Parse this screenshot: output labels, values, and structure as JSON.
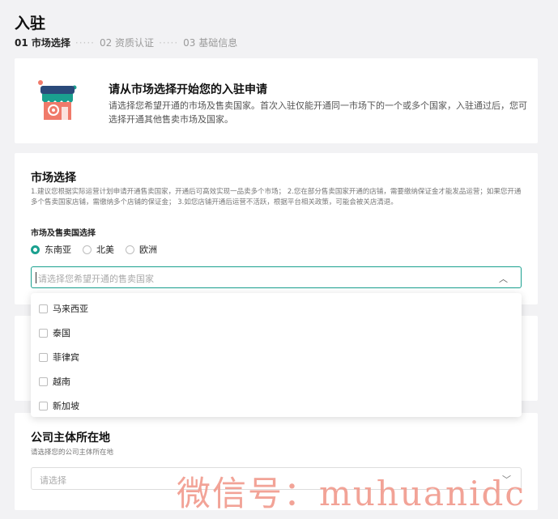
{
  "page": {
    "title": "入驻"
  },
  "steps": [
    {
      "label": "01 市场选择",
      "active": true
    },
    {
      "label": "02 资质认证",
      "active": false
    },
    {
      "label": "03 基础信息",
      "active": false
    }
  ],
  "steps_separator": "·····",
  "intro": {
    "icon": "shop-icon",
    "title": "请从市场选择开始您的入驻申请",
    "description": "请选择您希望开通的市场及售卖国家。首次入驻仅能开通同一市场下的一个或多个国家，入驻通过后，您可选择开通其他售卖市场及国家。"
  },
  "market": {
    "title": "市场选择",
    "description": "1.建议您根据实际运营计划申请开通售卖国家，开通后可高效实现一品卖多个市场； 2.您在部分售卖国家开通的店铺，需要缴纳保证金才能发品运营；如果您开通多个售卖国家店铺，需缴纳多个店铺的保证金； 3.如您店铺开通后运营不活跃，根据平台相关政策，可能会被关店清退。",
    "sub_label": "市场及售卖国选择",
    "regions": [
      {
        "label": "东南亚",
        "checked": true
      },
      {
        "label": "北美",
        "checked": false
      },
      {
        "label": "欧洲",
        "checked": false
      }
    ],
    "country_select": {
      "placeholder": "请选择您希望开通的售卖国家",
      "chevron": "chevron-up-icon"
    }
  },
  "country_options": [
    "马来西亚",
    "泰国",
    "菲律宾",
    "越南",
    "新加坡"
  ],
  "company": {
    "title": "公司主体所在地",
    "subtitle": "请选择您的公司主体所在地",
    "select_placeholder": "请选择"
  },
  "watermark": "微信号：muhuanidc",
  "colors": {
    "accent": "#1aa08f",
    "background": "#f2f2f4",
    "watermark": "#f19a8c"
  }
}
